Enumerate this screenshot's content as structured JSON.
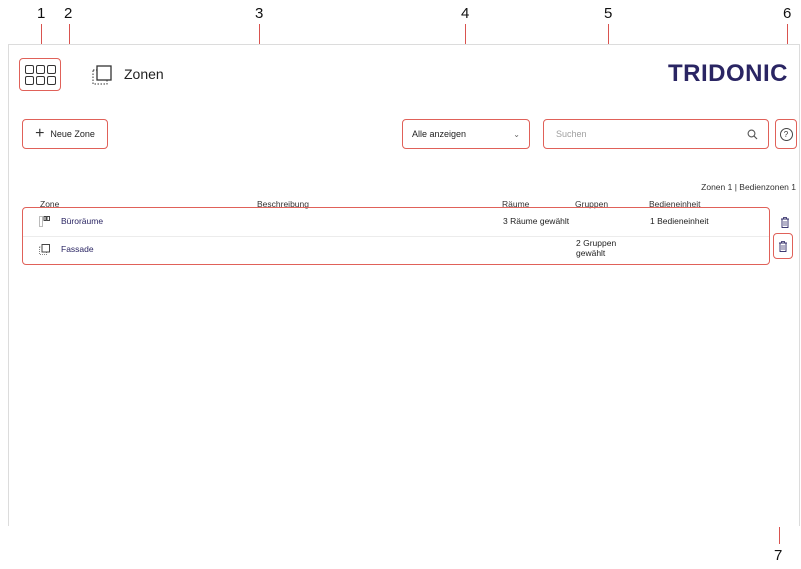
{
  "callouts": [
    "1",
    "2",
    "3",
    "4",
    "5",
    "6",
    "7"
  ],
  "header": {
    "page_title": "Zonen",
    "brand": "TRIDONIC"
  },
  "toolbar": {
    "new_zone_label": "Neue Zone",
    "filter_selected": "Alle anzeigen",
    "search_placeholder": "Suchen"
  },
  "counts_text": "Zonen 1 | Bedienzonen 1",
  "table": {
    "columns": [
      "Zone",
      "Beschreibung",
      "Räume",
      "Gruppen",
      "Bedieneinheit"
    ],
    "rows": [
      {
        "icon": "room-zone-icon",
        "zone": "Büroräume",
        "beschreibung": "",
        "raeume": "3 Räume gewählt",
        "gruppen": "",
        "bedieneinheit": "1 Bedieneinheit"
      },
      {
        "icon": "facade-zone-icon",
        "zone": "Fassade",
        "beschreibung": "",
        "raeume": "",
        "gruppen_line1": "2 Gruppen",
        "gruppen_line2": "gewählt",
        "bedieneinheit": ""
      }
    ]
  },
  "colors": {
    "callout_red": "#e06159",
    "brand_navy": "#2a2563"
  }
}
